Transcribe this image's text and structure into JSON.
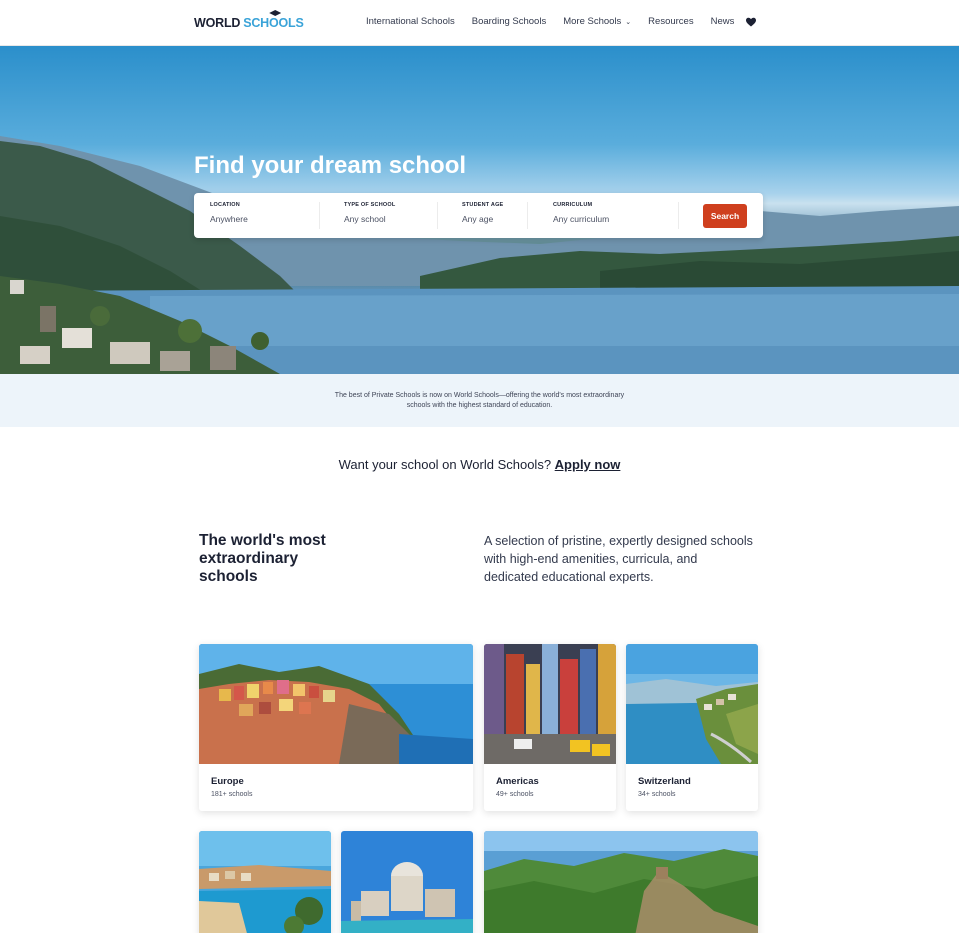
{
  "header": {
    "logo_part1": "WORLD",
    "logo_part2": "SCHOOLS",
    "nav": [
      {
        "label": "International Schools"
      },
      {
        "label": "Boarding Schools"
      },
      {
        "label": "More Schools"
      },
      {
        "label": "Resources"
      },
      {
        "label": "News"
      }
    ]
  },
  "hero": {
    "title": "Find your dream school",
    "search": {
      "fields": [
        {
          "label": "LOCATION",
          "value": "Anywhere"
        },
        {
          "label": "TYPE OF SCHOOL",
          "value": "Any school"
        },
        {
          "label": "STUDENT AGE",
          "value": "Any age"
        },
        {
          "label": "CURRICULUM",
          "value": "Any curriculum"
        }
      ],
      "button": "Search"
    }
  },
  "band": {
    "text": "The best of Private Schools is now on World Schools—offering the world's most extraordinary schools with the highest standard of education."
  },
  "apply": {
    "text": "Want your school on World Schools?",
    "link": "Apply now"
  },
  "featured": {
    "heading": "The world's most extraordinary schools",
    "description": "A selection of pristine, expertly designed schools with high-end amenities, curricula, and dedicated educational experts."
  },
  "cards": [
    {
      "name": "Europe",
      "count": "181+ schools"
    },
    {
      "name": "Americas",
      "count": "49+ schools"
    },
    {
      "name": "Switzerland",
      "count": "34+ schools"
    }
  ],
  "colors": {
    "accent": "#cf3f1e",
    "logo_blue": "#3aa3d8",
    "band_bg": "#edf4fa",
    "text_dark": "#1c2133"
  }
}
